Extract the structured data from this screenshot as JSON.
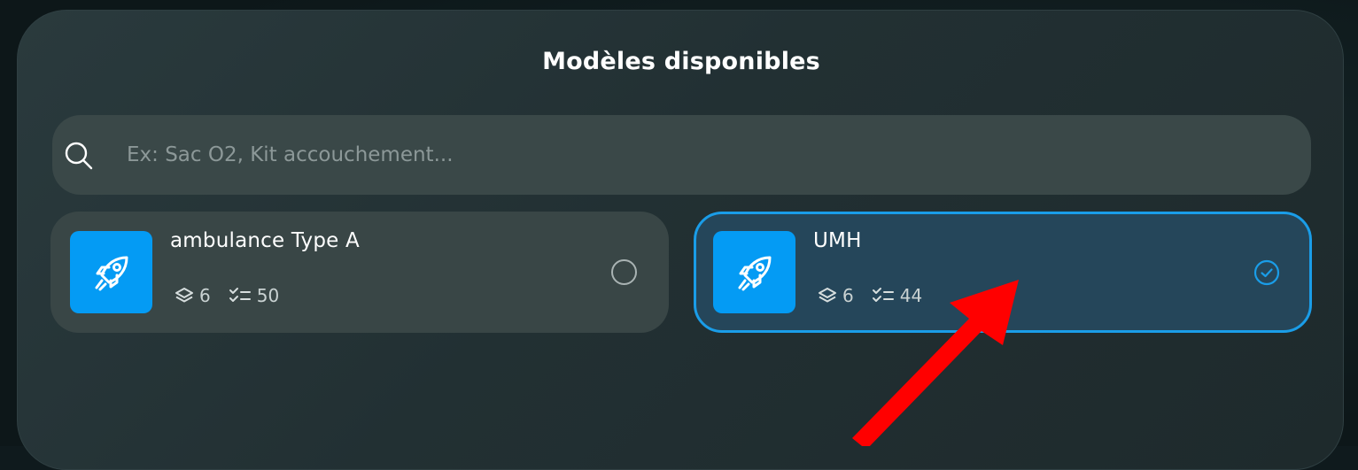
{
  "modal": {
    "title": "Modèles disponibles"
  },
  "search": {
    "placeholder": "Ex: Sac O2, Kit accouchement...",
    "value": ""
  },
  "models": [
    {
      "name": "ambulance Type A",
      "layers_count": "6",
      "checklist_count": "50",
      "selected": false,
      "icon": "rocket-icon"
    },
    {
      "name": "UMH",
      "layers_count": "6",
      "checklist_count": "44",
      "selected": true,
      "icon": "rocket-icon"
    }
  ],
  "colors": {
    "accent": "#049bf4",
    "selected_border": "#1a9de8",
    "annotation_arrow": "#ff0000"
  }
}
